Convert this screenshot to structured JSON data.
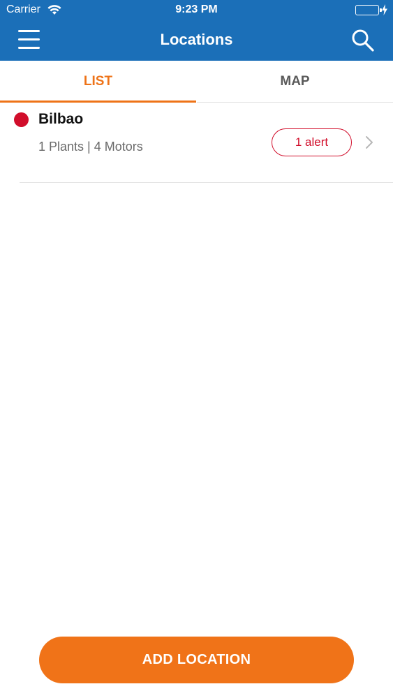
{
  "status_bar": {
    "carrier": "Carrier",
    "time": "9:23 PM"
  },
  "nav": {
    "title": "Locations",
    "menu_icon": "hamburger-menu-icon",
    "search_icon": "search-icon",
    "bar_color": "#1b6fb8"
  },
  "tabs": [
    {
      "label": "LIST",
      "active": true
    },
    {
      "label": "MAP",
      "active": false
    }
  ],
  "locations": [
    {
      "name": "Bilbao",
      "status_color": "#d10e2b",
      "summary": "1 Plants | 4 Motors",
      "alert_label": "1 alert"
    }
  ],
  "footer": {
    "add_label": "ADD LOCATION",
    "accent_color": "#f07318"
  }
}
